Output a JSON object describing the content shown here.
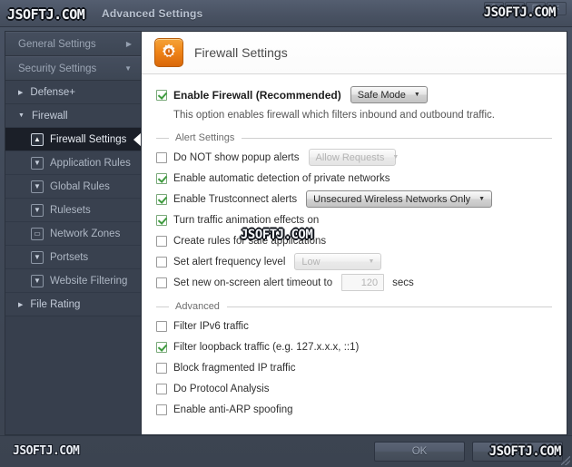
{
  "window": {
    "app_title": "Advanced Settings",
    "controls": [
      {
        "name": "help",
        "glyph": "?"
      },
      {
        "name": "minimize",
        "glyph": "–"
      },
      {
        "name": "maximize",
        "glyph": "□"
      },
      {
        "name": "close",
        "glyph": "×"
      }
    ]
  },
  "watermarks": {
    "title": "JSOFTJ.COM",
    "top_right": "JSOFTJ.COM",
    "middle": "JSOFTJ.COM",
    "bottom_left": "JSOFTJ.COM",
    "bottom_right": "JSOFTJ.COM"
  },
  "sidebar": {
    "sections": [
      {
        "label": "General Settings",
        "arrow": "▶",
        "expanded": false
      },
      {
        "label": "Security Settings",
        "arrow": "▼",
        "expanded": true
      }
    ],
    "groups": [
      {
        "label": "Defense+",
        "tri": "▶",
        "expanded": false
      },
      {
        "label": "Firewall",
        "tri": "▼",
        "expanded": true
      }
    ],
    "items": [
      {
        "label": "Firewall Settings",
        "icon": "shield-icon",
        "glyph": "▲",
        "active": true
      },
      {
        "label": "Application Rules",
        "icon": "filter-icon",
        "glyph": "▼",
        "active": false
      },
      {
        "label": "Global Rules",
        "icon": "monitor-icon",
        "glyph": "▼",
        "active": false
      },
      {
        "label": "Rulesets",
        "icon": "filter-icon",
        "glyph": "▼",
        "active": false
      },
      {
        "label": "Network Zones",
        "icon": "monitor-icon",
        "glyph": "▭",
        "active": false
      },
      {
        "label": "Portsets",
        "icon": "port-icon",
        "glyph": "▼",
        "active": false
      },
      {
        "label": "Website Filtering",
        "icon": "filter-icon",
        "glyph": "▼",
        "active": false
      }
    ],
    "footer_group": {
      "label": "File Rating",
      "tri": "▶",
      "expanded": false
    }
  },
  "panel": {
    "title": "Firewall Settings",
    "icon": "gear-icon",
    "enable": {
      "label": "Enable Firewall (Recommended)",
      "checked": true,
      "mode": "Safe Mode",
      "description": "This option enables firewall which filters inbound and outbound traffic."
    },
    "alert_section": {
      "title": "Alert Settings",
      "rows": [
        {
          "label": "Do NOT show popup alerts",
          "checked": false,
          "control": "dropdown",
          "value": "Allow Requests",
          "disabled": true,
          "width": "fixed"
        },
        {
          "label": "Enable automatic detection of private networks",
          "checked": true,
          "control": "none"
        },
        {
          "label": "Enable Trustconnect alerts",
          "checked": true,
          "control": "dropdown",
          "value": "Unsecured Wireless Networks Only",
          "disabled": false,
          "width": "wide"
        },
        {
          "label": "Turn traffic animation effects on",
          "checked": true,
          "control": "none"
        },
        {
          "label": "Create rules for safe applications",
          "checked": false,
          "control": "none"
        },
        {
          "label": "Set alert frequency level",
          "checked": false,
          "control": "dropdown",
          "value": "Low",
          "disabled": true,
          "width": "fixed"
        },
        {
          "label": "Set new on-screen alert timeout to",
          "checked": false,
          "control": "number",
          "value": "120",
          "unit": "secs",
          "disabled": true
        }
      ]
    },
    "advanced_section": {
      "title": "Advanced",
      "rows": [
        {
          "label": "Filter IPv6 traffic",
          "checked": false
        },
        {
          "label": "Filter loopback traffic (e.g. 127.x.x.x, ::1)",
          "checked": true
        },
        {
          "label": "Block fragmented IP traffic",
          "checked": false
        },
        {
          "label": "Do Protocol Analysis",
          "checked": false
        },
        {
          "label": "Enable anti-ARP spoofing",
          "checked": false
        }
      ]
    }
  },
  "footer": {
    "ok_label": "OK",
    "cancel_label": "Cancel"
  },
  "colors": {
    "accent_orange": "#ef8417",
    "check_green": "#3f9c3f",
    "window_bg": "#3d4654",
    "sidebar_bg": "#39414f",
    "active_item_bg": "#1b1f28",
    "panel_bg": "#ffffff"
  }
}
